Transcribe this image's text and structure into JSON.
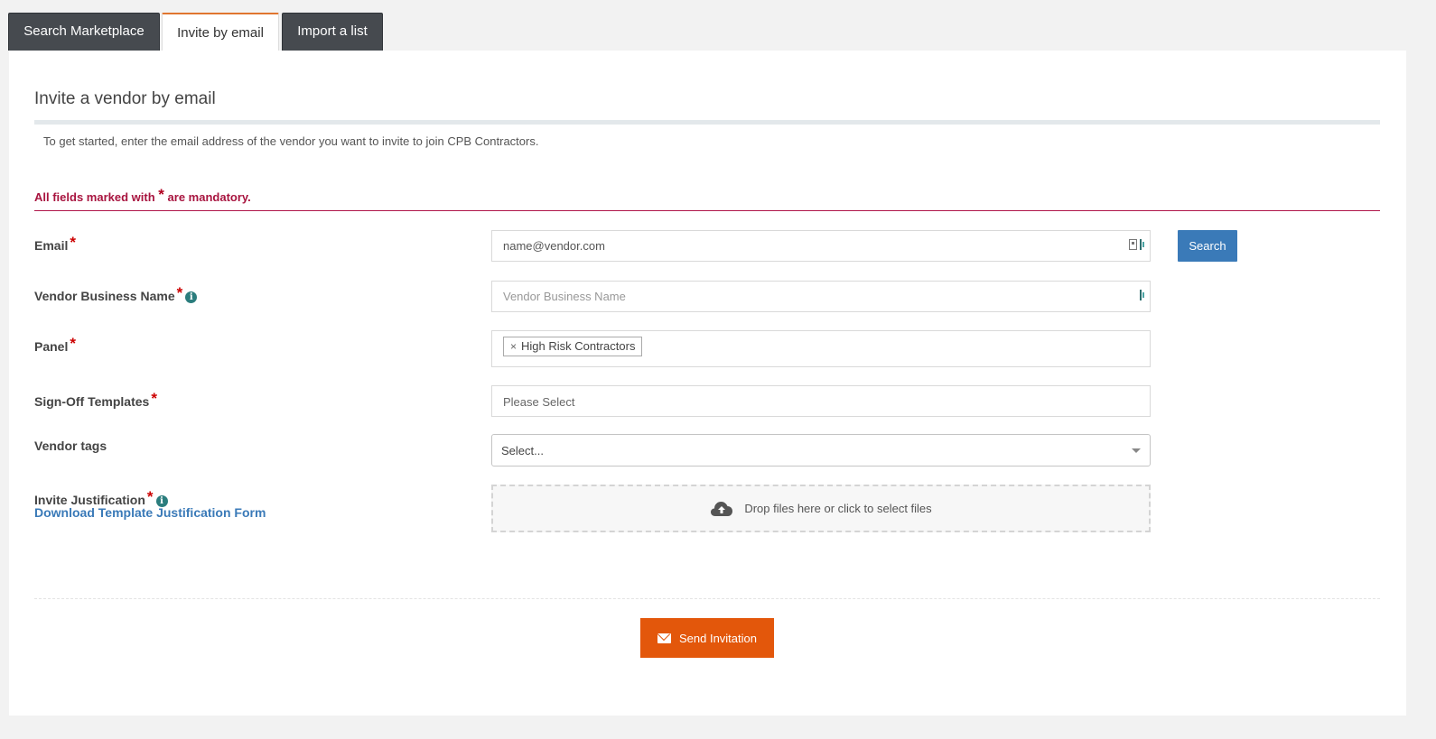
{
  "tabs": [
    {
      "label": "Search Marketplace",
      "active": false
    },
    {
      "label": "Invite by email",
      "active": true
    },
    {
      "label": "Import a list",
      "active": false
    }
  ],
  "page": {
    "heading": "Invite a vendor by email",
    "intro": "To get started, enter the email address of the vendor you want to invite to join CPB Contractors.",
    "mandatory_prefix": "All fields marked with",
    "mandatory_star": "*",
    "mandatory_suffix": "are mandatory."
  },
  "form": {
    "email": {
      "label": "Email",
      "value": "name@vendor.com",
      "placeholder": ""
    },
    "search_button": "Search",
    "business_name": {
      "label": "Vendor Business Name",
      "value": "",
      "placeholder": "Vendor Business Name"
    },
    "panel": {
      "label": "Panel",
      "chips": [
        "High Risk Contractors"
      ],
      "chip_remove": "×"
    },
    "signoff": {
      "label": "Sign-Off Templates",
      "placeholder": "Please Select"
    },
    "tags": {
      "label": "Vendor tags",
      "selected": "Select..."
    },
    "justification": {
      "label": "Invite Justification",
      "link": "Download Template Justification Form",
      "dropzone_text": "Drop files here or click to select files"
    },
    "required_mark": "*",
    "info_mark": "i"
  },
  "actions": {
    "send_button": "Send Invitation"
  },
  "colors": {
    "tab_dark": "#464a4f",
    "active_tab_accent": "#e0752f",
    "mandatory_text": "#a8143f",
    "search_button": "#3a7ab8",
    "send_button": "#e3570b",
    "info_icon": "#2b7d7d"
  },
  "icons": {
    "info": "info-icon",
    "contact_card": "contact-card-icon",
    "dashlane": "password-manager-icon",
    "upload": "cloud-upload-icon",
    "mail": "envelope-icon",
    "caret": "chevron-down-icon"
  }
}
